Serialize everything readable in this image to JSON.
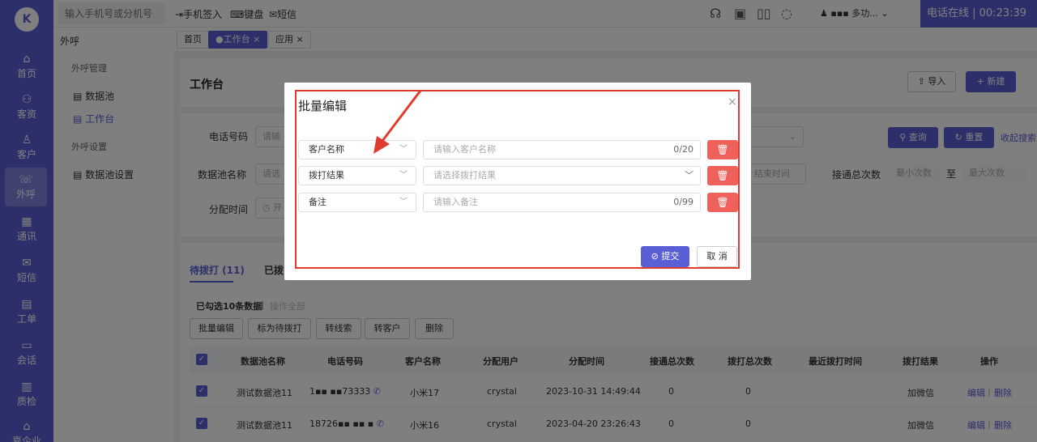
{
  "sidebar": {
    "logo": "K",
    "items": [
      {
        "label": "首页",
        "icon": "home-icon",
        "glyph": "⌂"
      },
      {
        "label": "客资",
        "icon": "customer-assets-icon",
        "glyph": "⚇"
      },
      {
        "label": "客户",
        "icon": "customer-icon",
        "glyph": "♙"
      },
      {
        "label": "外呼",
        "icon": "outbound-call-icon",
        "glyph": "☏"
      },
      {
        "label": "通讯",
        "icon": "contacts-icon",
        "glyph": "▦"
      },
      {
        "label": "短信",
        "icon": "sms-icon",
        "glyph": "✉"
      },
      {
        "label": "工单",
        "icon": "ticket-icon",
        "glyph": "▤"
      },
      {
        "label": "会话",
        "icon": "chat-icon",
        "glyph": "▭"
      },
      {
        "label": "质检",
        "icon": "quality-check-icon",
        "glyph": "▥"
      },
      {
        "label": "嘉企业",
        "icon": "enterprise-icon",
        "glyph": "⌂"
      }
    ]
  },
  "topbar": {
    "phone_placeholder": "输入手机号或分机号",
    "phone_signin": "手机签入",
    "keyboard": "键盘",
    "sms": "短信",
    "icons": [
      "headset-icon",
      "monitor-icon",
      "book-icon",
      "message-icon"
    ],
    "user_name": "多功...",
    "status": "电话在线 | 00:23:39"
  },
  "subnav": {
    "section": "外呼",
    "group1": "外呼管理",
    "item1": "数据池",
    "item2": "工作台",
    "group2": "外呼设置",
    "item3": "数据池设置"
  },
  "tabs": [
    {
      "label": "首页"
    },
    {
      "label": "●工作台 ×"
    },
    {
      "label": "应用 ×"
    }
  ],
  "workbench": {
    "title": "工作台",
    "import_label": "导入",
    "new_label": "+ 新建"
  },
  "filters": {
    "phone_label": "电话号码",
    "phone_placeholder": "请输",
    "pool_label": "数据池名称",
    "pool_placeholder": "请选",
    "assign_time_label": "分配时间",
    "assign_time_placeholder": "开",
    "end_time_placeholder": "结束时间",
    "total_connect_label": "接通总次数",
    "min_placeholder": "最小次数",
    "to": "至",
    "max_placeholder": "最大次数",
    "query": "查询",
    "reset": "重置",
    "collapse": "收起搜索"
  },
  "list": {
    "tab_pending": "待拨打 (11)",
    "tab_done": "已拨",
    "selected_info": "已勾选10条数据",
    "separator": "|",
    "op_all": "操作全部",
    "actions": [
      "批量编辑",
      "标为待拨打",
      "转线索",
      "转客户",
      "删除"
    ],
    "columns": [
      "数据池名称",
      "电话号码",
      "客户名称",
      "分配用户",
      "分配时间",
      "接通总次数",
      "拨打总次数",
      "最近拨打时间",
      "拨打结果",
      "操作"
    ],
    "rows": [
      {
        "pool": "测试数据池11",
        "phone": "1▪▪ ▪▪73333",
        "name": "小米17",
        "user": "crystal",
        "time": "2023-10-31 14:49:44",
        "connect": "0",
        "dial": "0",
        "last": "",
        "result": "加微信",
        "edit": "编辑",
        "del": "删除"
      },
      {
        "pool": "测试数据池11",
        "phone": "18726▪▪ ▪▪ ▪",
        "name": "小米16",
        "user": "crystal",
        "time": "2023-04-20 23:26:43",
        "connect": "0",
        "dial": "0",
        "last": "",
        "result": "加微信",
        "edit": "编辑",
        "del": "删除"
      }
    ]
  },
  "modal": {
    "title": "批量编辑",
    "close": "×",
    "rows": [
      {
        "field": "客户名称",
        "placeholder": "请输入客户名称",
        "counter": "0/20"
      },
      {
        "field": "拨打结果",
        "placeholder": "请选择拨打结果",
        "counter": ""
      },
      {
        "field": "备注",
        "placeholder": "请输入备注",
        "counter": "0/99"
      }
    ],
    "submit": "提交",
    "cancel": "取 消"
  },
  "colors": {
    "accent": "#5b5fd6",
    "danger": "#f0615b",
    "highlight": "#e03b2e"
  }
}
